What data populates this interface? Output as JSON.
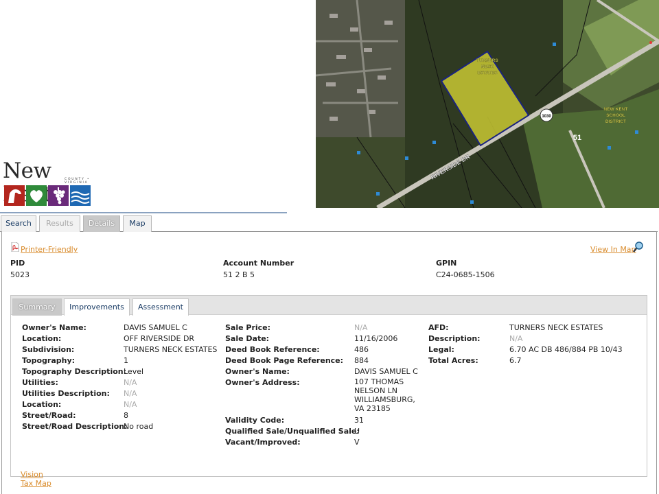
{
  "logo": {
    "title": "New Kent",
    "subtitle": "COUNTY • VIRGINIA"
  },
  "map": {
    "parcel_label": [
      "TURNERS",
      "NECK",
      "ESTATES"
    ],
    "school_label": [
      "NEW KENT",
      "SCHOOL",
      "DISTRICT"
    ],
    "road_label": "RIVERSIDE DR",
    "route_shield": "1030",
    "route_number": "51"
  },
  "tabs": [
    {
      "label": "Search"
    },
    {
      "label": "Results"
    },
    {
      "label": "Details"
    },
    {
      "label": "Map"
    }
  ],
  "links": {
    "printer": "Printer-Friendly",
    "view_map": "View In Map"
  },
  "header": {
    "pid_label": "PID",
    "pid": "5023",
    "account_label": "Account Number",
    "account": "51 2 B 5",
    "gpin_label": "GPIN",
    "gpin": "C24-0685-1506"
  },
  "inner_tabs": [
    {
      "label": "Summary"
    },
    {
      "label": "Improvements"
    },
    {
      "label": "Assessment"
    }
  ],
  "col1": [
    {
      "label": "Owner's Name:",
      "value": "DAVIS SAMUEL C"
    },
    {
      "label": "Location:",
      "value": "OFF RIVERSIDE DR"
    },
    {
      "label": "Subdivision:",
      "value": "TURNERS NECK ESTATES"
    },
    {
      "label": "Topography:",
      "value": "1"
    },
    {
      "label": "Topography Description:",
      "value": "Level"
    },
    {
      "label": "Utilities:",
      "value": "N/A"
    },
    {
      "label": "Utilities Description:",
      "value": "N/A"
    },
    {
      "label": "Location:",
      "value": "N/A"
    },
    {
      "label": "Street/Road:",
      "value": "8"
    },
    {
      "label": "Street/Road Description:",
      "value": "No road"
    }
  ],
  "col2": [
    {
      "label": "Sale Price:",
      "value": "N/A"
    },
    {
      "label": "Sale Date:",
      "value": "11/16/2006"
    },
    {
      "label": "Deed Book Reference:",
      "value": "486"
    },
    {
      "label": "Deed Book Page Reference:",
      "value": "884"
    },
    {
      "label": "Owner's Name:",
      "value": "DAVIS SAMUEL C"
    },
    {
      "label": "Owner's Address:",
      "value_lines": [
        "107 THOMAS",
        "NELSON LN",
        "WILLIAMSBURG,",
        "VA 23185"
      ]
    },
    {
      "label": "Validity Code:",
      "value": "31"
    },
    {
      "label": "Qualified Sale/Unqualified Sale:",
      "value": "U"
    },
    {
      "label": "Vacant/Improved:",
      "value": "V"
    }
  ],
  "col3": [
    {
      "label": "AFD:",
      "value": "TURNERS NECK ESTATES"
    },
    {
      "label": "Description:",
      "value": "N/A"
    },
    {
      "label": "Legal:",
      "value": "6.70 AC DB 486/884 PB 10/43"
    },
    {
      "label": "Total Acres:",
      "value": "6.7"
    }
  ],
  "bottom_links": {
    "vision": "Vision",
    "tax_map": "Tax Map"
  },
  "colors": {
    "link": "#d98b2b",
    "tab_text": "#183a63",
    "na": "#a8a8a8",
    "parcel": "#c8c832",
    "parcel_border": "#1a237e"
  }
}
